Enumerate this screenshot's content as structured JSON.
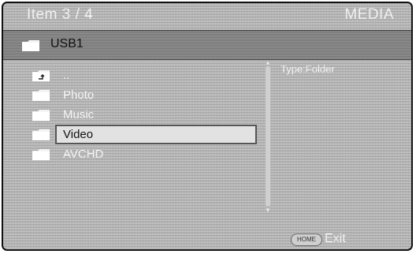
{
  "header": {
    "title": "Item 3 / 4",
    "section": "MEDIA"
  },
  "path": {
    "label": "USB1",
    "icon": "folder-icon"
  },
  "list": {
    "items": [
      {
        "label": "..",
        "icon": "folder-up-icon"
      },
      {
        "label": "Photo",
        "icon": "folder-icon"
      },
      {
        "label": "Music",
        "icon": "folder-icon"
      },
      {
        "label": "Video",
        "icon": "folder-icon"
      },
      {
        "label": "AVCHD",
        "icon": "folder-icon"
      }
    ],
    "selected": "Video"
  },
  "info": {
    "type_text": "Type:Folder"
  },
  "footer": {
    "home_label": "HOME",
    "exit_label": "Exit"
  }
}
